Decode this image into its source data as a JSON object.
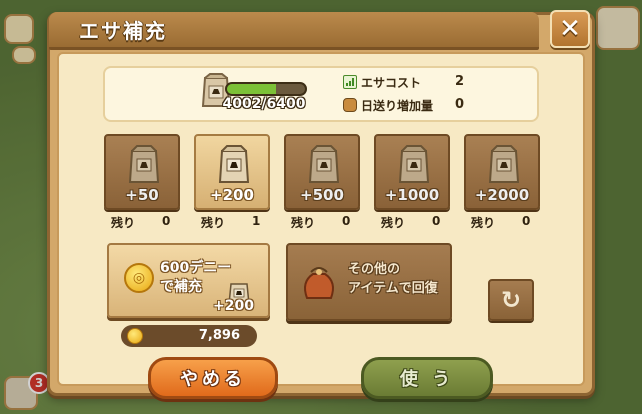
{
  "dialog": {
    "title": "エサ補充",
    "close_label": "✕"
  },
  "food": {
    "gauge_text": "4002/6400",
    "gauge_fraction": 0.625,
    "cost_label": "エサコスト",
    "cost_value": "2",
    "daily_label": "日送り増加量",
    "daily_value": "0"
  },
  "packs": [
    {
      "amount": "+50",
      "stock_label": "残り",
      "stock": "0"
    },
    {
      "amount": "+200",
      "stock_label": "残り",
      "stock": "1"
    },
    {
      "amount": "+500",
      "stock_label": "残り",
      "stock": "0"
    },
    {
      "amount": "+1000",
      "stock_label": "残り",
      "stock": "0"
    },
    {
      "amount": "+2000",
      "stock_label": "残り",
      "stock": "0"
    }
  ],
  "buy": {
    "line1": "600デニー",
    "line2": "で補充",
    "amount": "+200",
    "balance": "7,896"
  },
  "other": {
    "line1": "その他の",
    "line2": "アイテムで回復"
  },
  "buttons": {
    "cancel_label": "やめる",
    "use_label": "使 う"
  },
  "hud": {
    "badge_count": "3"
  },
  "colors": {
    "accent_orange": "#e06a1b",
    "gauge_green": "#7cc137",
    "frame_brown": "#8e6532"
  }
}
